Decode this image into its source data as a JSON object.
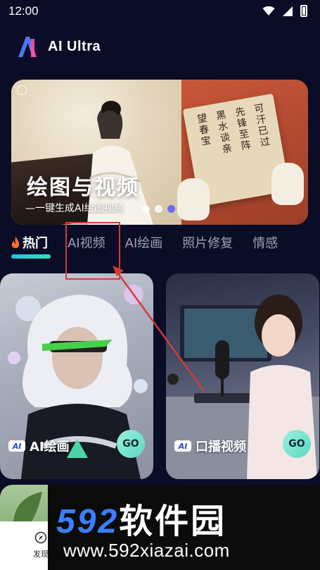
{
  "status_bar": {
    "time": "12:00"
  },
  "header": {
    "app_title": "AI Ultra"
  },
  "banner": {
    "title": "绘图与视频",
    "subtitle": "一键生成AI绘图视频",
    "calligraphy_lines": [
      "可汗已过",
      "先锋至阵",
      "黑水谈亲",
      "望春宝"
    ],
    "active_dot_index": 2,
    "dot_count": 3
  },
  "tabs": [
    {
      "label": "热门",
      "active": true
    },
    {
      "label": "AI视频",
      "active": false
    },
    {
      "label": "AI绘画",
      "active": false
    },
    {
      "label": "照片修复",
      "active": false
    },
    {
      "label": "情感",
      "active": false
    }
  ],
  "cards": [
    {
      "badge": "AI",
      "label": "AI绘画",
      "go": "GO"
    },
    {
      "badge": "AI",
      "label": "口播视频",
      "go": "GO"
    }
  ],
  "bottom_nav": {
    "discover_label": "发现"
  },
  "watermark": {
    "number": "592",
    "name": "软件园",
    "url": "www.592xiazai.com"
  },
  "colors": {
    "background": "#0b0d26",
    "tab_accent": "#2ee6b5",
    "annotation_red": "#d63a3a",
    "go_button": "#5cd8c0",
    "watermark_blue": "#3b7fff"
  }
}
